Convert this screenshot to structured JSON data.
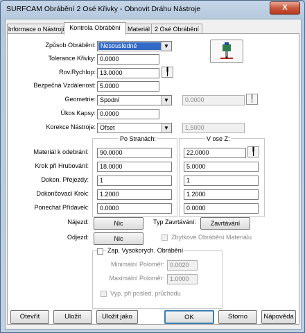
{
  "window": {
    "title": "SURFCAM Obrábění 2 Osé Křivky - Obnovit Dráhu Nástroje",
    "close_label": "X"
  },
  "tabs": [
    {
      "label": "Informace o Nástroji"
    },
    {
      "label": "Kontrola Obrábění"
    },
    {
      "label": "Materiál"
    },
    {
      "label": "2 Osé Obrábění"
    }
  ],
  "form": {
    "mode": {
      "label": "Způsob Obrábění:",
      "value": "Nesousledné"
    },
    "tolerance": {
      "label": "Tolerance Křivky:",
      "value": "0.0000"
    },
    "rapid_plane": {
      "label": "Rov.Rychlop:",
      "value": "13.0000"
    },
    "safe_distance": {
      "label": "Bezpečná Vzdálenost:",
      "value": "5.0000"
    },
    "geometry": {
      "label": "Geometrie:",
      "value": "Spodní",
      "extra": "0.0000"
    },
    "pocket_angle": {
      "label": "Úkos Kapsy:",
      "value": "0.0000"
    },
    "tool_comp": {
      "label": "Korekce Nástroje:",
      "value": "Ofset",
      "extra": "1.5000"
    }
  },
  "cuts": {
    "header_side": "Po Stranách:",
    "header_z": "V ose Z:",
    "rows": [
      {
        "label": "Materiál k odebrání:",
        "side": "90.0000",
        "z": "22.0000"
      },
      {
        "label": "Krok při Hrubování:",
        "side": "18.0000",
        "z": "5.0000"
      },
      {
        "label": "Dokon. Přejezdy:",
        "side": "1",
        "z": "1"
      },
      {
        "label": "Dokončovací Krok:",
        "side": "1.2000",
        "z": "1.2000"
      },
      {
        "label": "Ponechat Přídavek:",
        "side": "0.0000",
        "z": "0.0000"
      }
    ]
  },
  "approach": {
    "entry_label": "Nájezd:",
    "entry_button": "Nic",
    "exit_label": "Odjezd:",
    "exit_button": "Nic",
    "type_label": "Typ Zavrtávání:",
    "type_button": "Zavrtávání",
    "rest_material": "Zbytkové Obrábění Materiálu"
  },
  "high_speed": {
    "enable": "Zap. Vysokorych. Obrábění",
    "min_radius_label": "Minimální Poloměr:",
    "min_radius": "0.0020",
    "max_radius_label": "Maximální Poloměr:",
    "max_radius": "1.0000",
    "last_pass": "Vyp. při posled. průchodu"
  },
  "footer": {
    "open": "Otevřít",
    "save": "Uložit",
    "save_as": "Uložit jako",
    "ok": "OK",
    "cancel": "Storno",
    "help": "Nápověda"
  },
  "colors": {
    "selection": "#3169c6",
    "title_close": "#c95a40",
    "frame": "#b6c9de"
  },
  "icons": {
    "tool_preview": "tool-preview-icon",
    "pick": "pick-icon"
  }
}
